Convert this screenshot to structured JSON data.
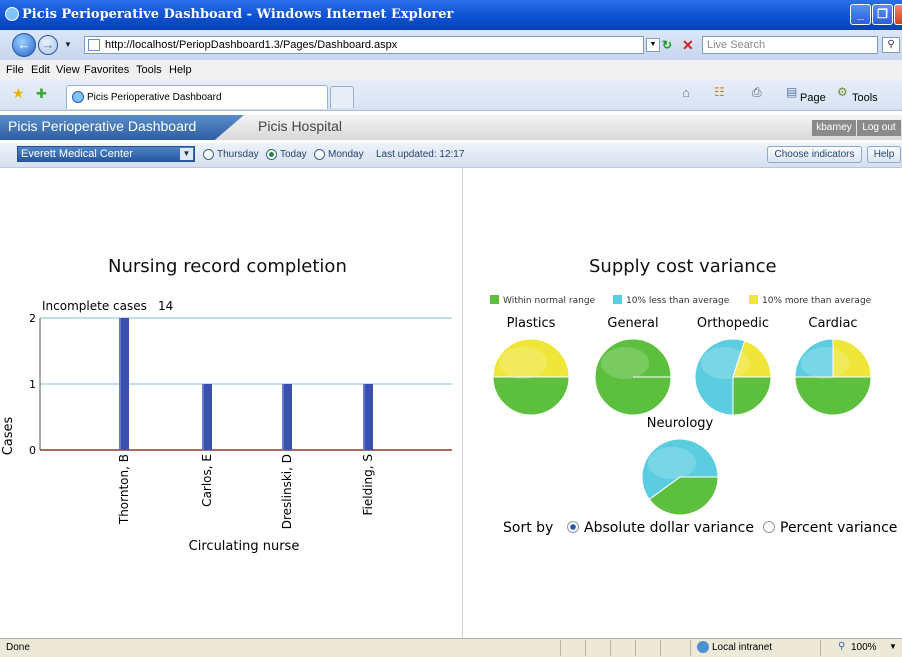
{
  "window": {
    "title": "Picis Perioperative Dashboard - Windows Internet Explorer",
    "address": "http://localhost/PeriopDashboard1.3/Pages/Dashboard.aspx",
    "search_placeholder": "Live Search",
    "menu": [
      "File",
      "Edit",
      "View",
      "Favorites",
      "Tools",
      "Help"
    ],
    "tab_label": "Picis Perioperative Dashboard",
    "toolbar_page": "Page",
    "toolbar_tools": "Tools",
    "status_left": "Done",
    "status_zone": "Local intranet",
    "zoom": "100%"
  },
  "app": {
    "title": "Picis Perioperative Dashboard",
    "hospital": "Picis Hospital",
    "user": "kbarney",
    "logout": "Log out",
    "facility": "Everett Medical Center",
    "days": [
      "Thursday",
      "Today",
      "Monday"
    ],
    "selected_day": "Today",
    "last_updated": "Last updated: 12:17",
    "choose_indicators": "Choose indicators",
    "help": "Help"
  },
  "nursing": {
    "title": "Nursing record completion",
    "incomplete_label": "Incomplete cases",
    "incomplete_count": "14",
    "chart_data": {
      "type": "bar",
      "categories": [
        "Thornton, B",
        "Carlos, E",
        "Dreslinski, D",
        "Fielding, S"
      ],
      "values": [
        2,
        1,
        1,
        1
      ],
      "ylim": [
        0,
        2
      ],
      "yticks": [
        "0",
        "1",
        "2"
      ],
      "xlabel": "Circulating nurse",
      "ylabel": "Cases",
      "bar_color": "#3b4fae"
    }
  },
  "supply": {
    "title": "Supply cost variance",
    "legend": [
      {
        "label": "Within normal range",
        "color": "#5cbf3d"
      },
      {
        "label": "10% less than average",
        "color": "#5ccde0"
      },
      {
        "label": "10% more than average",
        "color": "#f0e63a"
      }
    ],
    "chart_data": [
      {
        "type": "pie",
        "title": "Plastics",
        "slices": [
          {
            "name": "Within normal range",
            "value": 50
          },
          {
            "name": "10% more than average",
            "value": 50
          }
        ]
      },
      {
        "type": "pie",
        "title": "General",
        "slices": [
          {
            "name": "Within normal range",
            "value": 100
          }
        ]
      },
      {
        "type": "pie",
        "title": "Orthopedic",
        "slices": [
          {
            "name": "Within normal range",
            "value": 25
          },
          {
            "name": "10% less than average",
            "value": 55
          },
          {
            "name": "10% more than average",
            "value": 20
          }
        ]
      },
      {
        "type": "pie",
        "title": "Cardiac",
        "slices": [
          {
            "name": "Within normal range",
            "value": 50
          },
          {
            "name": "10% less than average",
            "value": 25
          },
          {
            "name": "10% more than average",
            "value": 25
          }
        ]
      },
      {
        "type": "pie",
        "title": "Neurology",
        "slices": [
          {
            "name": "Within normal range",
            "value": 40
          },
          {
            "name": "10% less than average",
            "value": 60
          }
        ]
      }
    ],
    "sort_label": "Sort by",
    "sort_options": [
      "Absolute dollar variance",
      "Percent variance"
    ],
    "sort_selected": "Absolute dollar variance"
  }
}
